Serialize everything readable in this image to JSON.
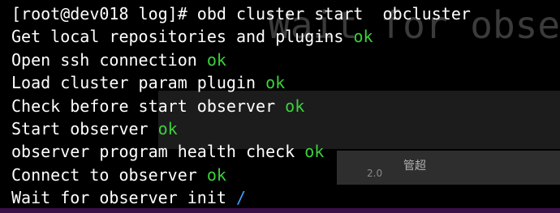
{
  "terminal": {
    "prompt_line": "[root@dev018 log]# obd cluster start  obcluster",
    "steps": [
      {
        "text": "Get local repositories and plugins",
        "status": "ok"
      },
      {
        "text": "Open ssh connection",
        "status": "ok"
      },
      {
        "text": "Load cluster param plugin",
        "status": "ok"
      },
      {
        "text": "Check before start observer",
        "status": "ok"
      },
      {
        "text": "Start observer",
        "status": "ok"
      },
      {
        "text": "observer program health check",
        "status": "ok"
      },
      {
        "text": "Connect to observer",
        "status": "ok"
      }
    ],
    "current_step": {
      "text": "Wait for observer init",
      "spinner": "/"
    }
  },
  "colors": {
    "ok": "#3bd13b",
    "spinner": "#3ea0ff",
    "text": "#ffffff",
    "background": "#000000"
  },
  "background_window": {
    "overlay_text": "Wait for observer i",
    "dialog_title": "管超",
    "version": "2.0"
  }
}
